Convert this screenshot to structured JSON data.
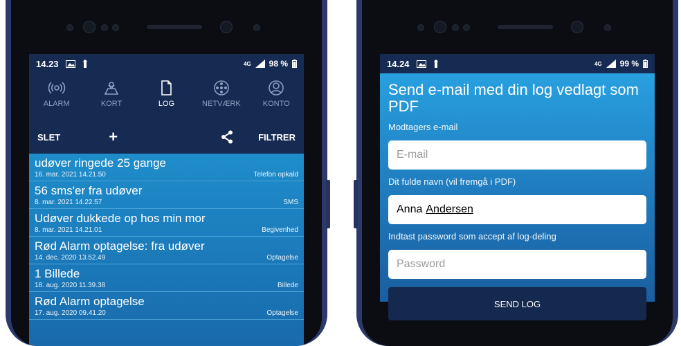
{
  "left_phone": {
    "status": {
      "time": "14.23",
      "network": "4G",
      "battery": "98 %"
    },
    "nav": [
      {
        "label": "ALARM",
        "icon": "alarm-broadcast-icon",
        "active": false
      },
      {
        "label": "KORT",
        "icon": "map-icon",
        "active": false
      },
      {
        "label": "LOG",
        "icon": "document-icon",
        "active": true
      },
      {
        "label": "NETVÆRK",
        "icon": "network-icon",
        "active": false
      },
      {
        "label": "KONTO",
        "icon": "account-icon",
        "active": false
      }
    ],
    "toolbar": {
      "delete": "SLET",
      "add": "+",
      "filter": "FILTRER"
    },
    "log": [
      {
        "title": "udøver ringede 25 gange",
        "date": "16. mar. 2021 14.21.50",
        "type": "Telefon opkald"
      },
      {
        "title": "56 sms'er fra udøver",
        "date": "8. mar. 2021 14.22.57",
        "type": "SMS"
      },
      {
        "title": "Udøver dukkede op hos min mor",
        "date": "8. mar. 2021 14.21.01",
        "type": "Begivenhed"
      },
      {
        "title": "Rød Alarm optagelse: fra udøver",
        "date": "14. dec. 2020 13.52.49",
        "type": "Optagelse"
      },
      {
        "title": "1 Billede",
        "date": "18. aug. 2020 11.39.38",
        "type": "Billede"
      },
      {
        "title": "Rød Alarm optagelse",
        "date": "17. aug. 2020 09.41.20",
        "type": "Optagelse"
      }
    ]
  },
  "right_phone": {
    "status": {
      "time": "14.24",
      "network": "4G",
      "battery": "99 %"
    },
    "form": {
      "heading": "Send e-mail med din log vedlagt som PDF",
      "email_label": "Modtagers e-mail",
      "email_placeholder": "E-mail",
      "name_label": "Dit fulde navn (vil fremgå i PDF)",
      "name_first": "Anna",
      "name_last": "Andersen",
      "password_label": "Indtast password som accept af log-deling",
      "password_placeholder": "Password",
      "send_label": "SEND LOG"
    }
  },
  "colors": {
    "frame": "#2b3a6b",
    "header_bg": "#162a52",
    "list_top": "#1f8dcb",
    "list_bottom": "#1867a9",
    "button": "#15284e"
  }
}
